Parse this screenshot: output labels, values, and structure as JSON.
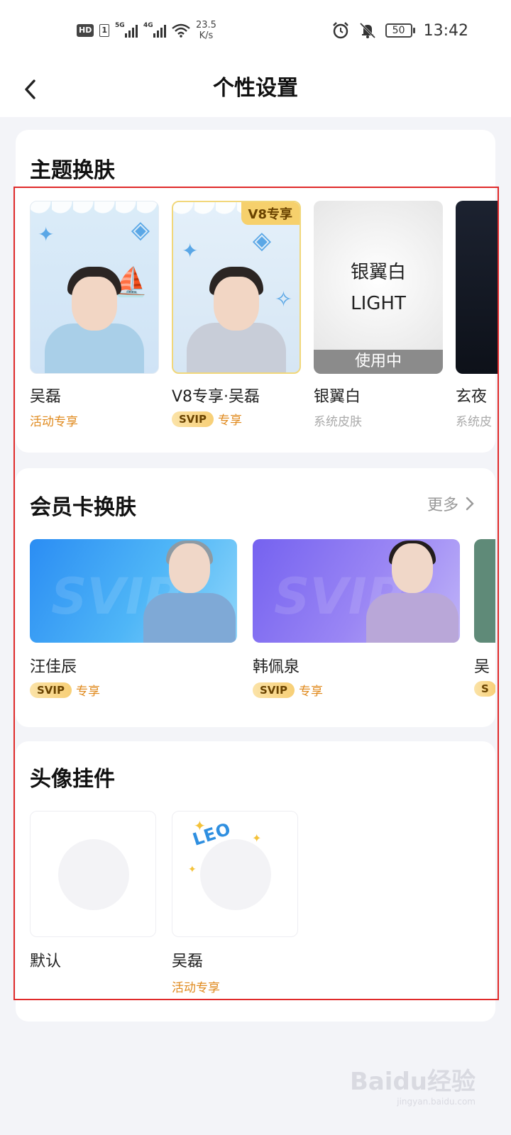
{
  "status_bar": {
    "hd": "HD",
    "sim": "1",
    "sig1": "5G",
    "sig2": "4G",
    "speed_value": "23.5",
    "speed_unit": "K/s",
    "battery": "50",
    "time": "13:42"
  },
  "header": {
    "title": "个性设置",
    "back_icon": "chevron-left-icon"
  },
  "theme_section": {
    "title": "主题换肤",
    "items": [
      {
        "name": "吴磊",
        "tag": "活动专享"
      },
      {
        "name": "V8专享·吴磊",
        "badge": "V8专享",
        "svip": "SVIP",
        "tag": "专享"
      },
      {
        "name": "银翼白",
        "tile_cn": "银翼白",
        "tile_en": "LIGHT",
        "status": "使用中",
        "tag": "系统皮肤"
      },
      {
        "name": "玄夜",
        "tag": "系统皮"
      }
    ]
  },
  "member_section": {
    "title": "会员卡换肤",
    "more": "更多",
    "items": [
      {
        "name": "汪佳辰",
        "svip": "SVIP",
        "tag": "专享"
      },
      {
        "name": "韩佩泉",
        "svip": "SVIP",
        "tag": "专享"
      },
      {
        "name": "吴",
        "svip": "S"
      }
    ]
  },
  "avatar_section": {
    "title": "头像挂件",
    "items": [
      {
        "name": "默认"
      },
      {
        "name": "吴磊",
        "tag": "活动专享",
        "ornament_text": "LEO"
      }
    ]
  },
  "colors": {
    "accent_orange": "#e08a1e",
    "highlight_box": "#e02a2a",
    "svip_gold": "#f7cf76"
  },
  "watermark": {
    "brand": "Baidu经验",
    "url": "jingyan.baidu.com"
  }
}
